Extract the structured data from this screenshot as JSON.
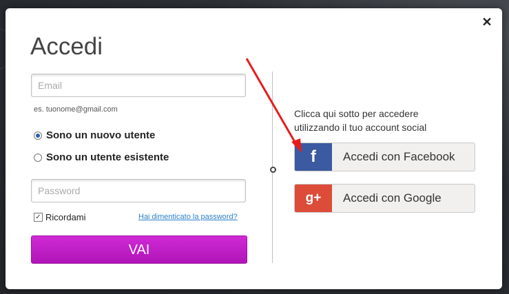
{
  "modal": {
    "title": "Accedi",
    "close_symbol": "✕"
  },
  "form": {
    "email_placeholder": "Email",
    "email_hint": "es. tuonome@gmail.com",
    "radio_new_user": "Sono un nuovo utente",
    "radio_existing_user": "Sono un utente esistente",
    "selected_radio": "new_user",
    "password_placeholder": "Password",
    "remember_label": "Ricordami",
    "remember_checked": true,
    "forgot_link": "Hai dimenticato la password?",
    "submit_label": "VAI"
  },
  "social": {
    "intro_line1": "Clicca qui sotto per accedere",
    "intro_line2": "utilizzando il tuo account social",
    "facebook": {
      "icon_glyph": "f",
      "label": "Accedi con Facebook",
      "color": "#3b5a9f"
    },
    "google": {
      "icon_glyph": "g+",
      "label": "Accedi con Google",
      "color": "#dd4b39"
    }
  },
  "colors": {
    "submit": "#c11fc7",
    "annotation_arrow": "#e81b1b",
    "link": "#2a7fc9"
  }
}
